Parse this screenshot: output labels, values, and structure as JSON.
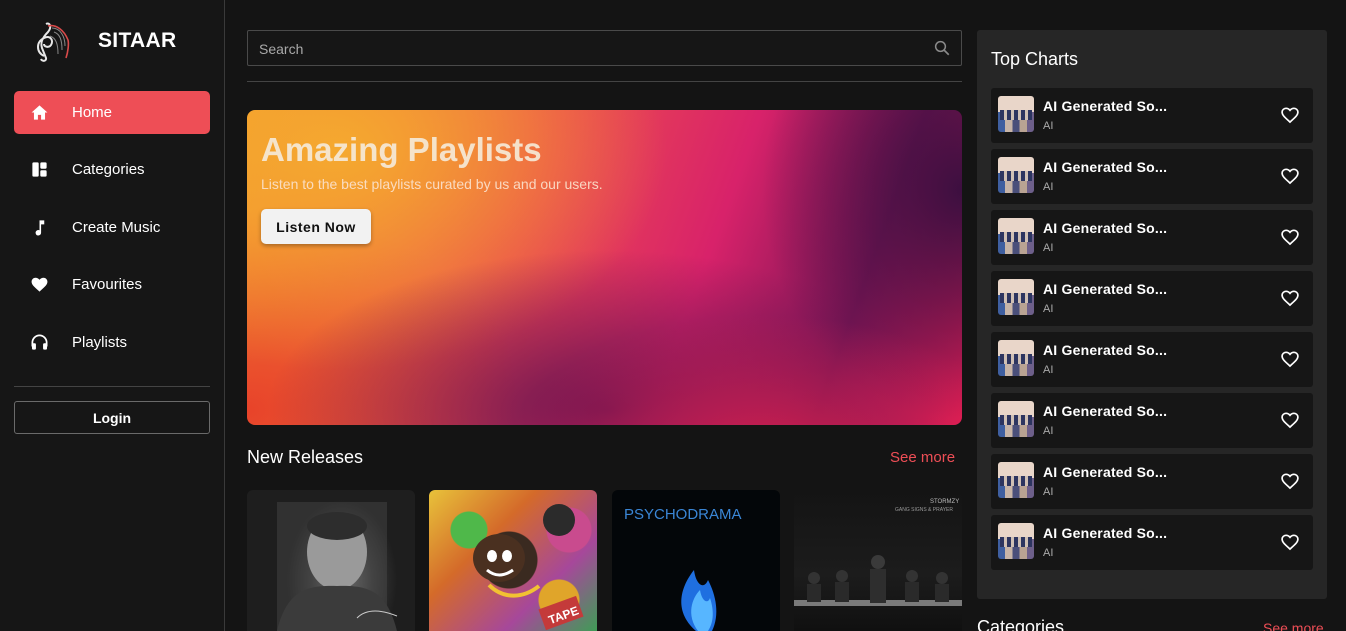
{
  "brand": {
    "name": "SITAAR",
    "logo_icon": "treble-clef-logo"
  },
  "colors": {
    "accent": "#ee4e56",
    "background": "#141414",
    "sidebar": "#161616",
    "panel": "#262626"
  },
  "sidebar": {
    "items": [
      {
        "label": "Home",
        "icon": "home-icon",
        "active": true
      },
      {
        "label": "Categories",
        "icon": "dashboard-icon",
        "active": false
      },
      {
        "label": "Create Music",
        "icon": "music-note-icon",
        "active": false
      },
      {
        "label": "Favourites",
        "icon": "heart-icon",
        "active": false
      },
      {
        "label": "Playlists",
        "icon": "headphones-icon",
        "active": false
      }
    ],
    "login_label": "Login"
  },
  "search": {
    "placeholder": "Search",
    "value": ""
  },
  "hero": {
    "title": "Amazing Playlists",
    "subtitle": "Listen to the best playlists curated by us and our users.",
    "button_label": "Listen Now"
  },
  "new_releases": {
    "title": "New Releases",
    "see_more": "See more",
    "covers": [
      {
        "id": "cover-1",
        "text": ""
      },
      {
        "id": "cover-2",
        "text": "TAPE"
      },
      {
        "id": "cover-3",
        "text": "PSYCHODRAMA"
      },
      {
        "id": "cover-4",
        "text": "STORMZY",
        "subtext": "GANG SIGNS & PRAYER"
      }
    ]
  },
  "top_charts": {
    "title": "Top Charts",
    "items": [
      {
        "name": "AI Generated So...",
        "artist": "AI"
      },
      {
        "name": "AI Generated So...",
        "artist": "AI"
      },
      {
        "name": "AI Generated So...",
        "artist": "AI"
      },
      {
        "name": "AI Generated So...",
        "artist": "AI"
      },
      {
        "name": "AI Generated So...",
        "artist": "AI"
      },
      {
        "name": "AI Generated So...",
        "artist": "AI"
      },
      {
        "name": "AI Generated So...",
        "artist": "AI"
      },
      {
        "name": "AI Generated So...",
        "artist": "AI"
      }
    ]
  },
  "categories": {
    "title": "Categories",
    "see_more": "See more"
  }
}
